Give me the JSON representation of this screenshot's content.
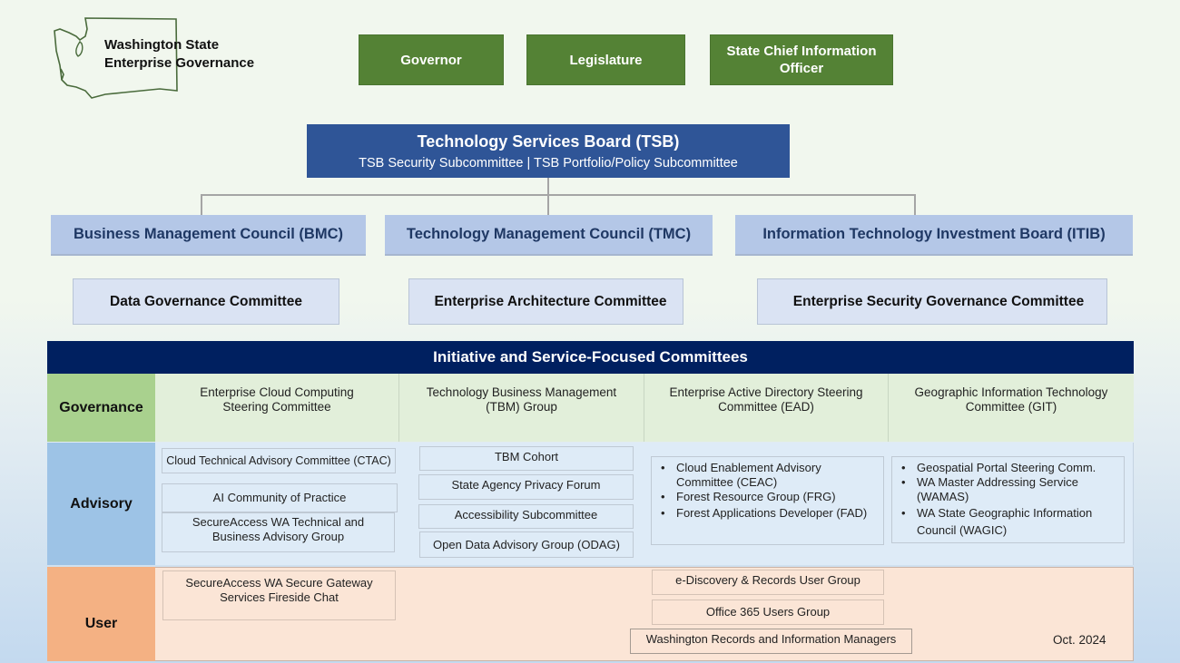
{
  "header": {
    "logo_icon": "washington-state-map-outline",
    "title_line1": "Washington State",
    "title_line2": "Enterprise Governance"
  },
  "top_authorities": [
    {
      "label": "Governor"
    },
    {
      "label": "Legislature"
    },
    {
      "label": "State Chief Information Officer"
    }
  ],
  "tsb": {
    "title": "Technology Services Board (TSB)",
    "subcommittees": "TSB Security Subcommittee | TSB Portfolio/Policy Subcommittee"
  },
  "councils": [
    {
      "label": "Business Management Council (BMC)",
      "committee": "Data Governance Committee"
    },
    {
      "label": "Technology Management Council (TMC)",
      "committee": "Enterprise Architecture Committee"
    },
    {
      "label": "Information Technology Investment Board (ITIB)",
      "committee": "Enterprise Security Governance Committee"
    }
  ],
  "initiatives": {
    "banner": "Initiative and Service-Focused Committees",
    "rows": {
      "governance": {
        "label": "Governance",
        "cells": [
          "Enterprise Cloud Computing Steering Committee",
          "Technology Business Management (TBM) Group",
          "Enterprise Active Directory Steering Committee (EAD)",
          "Geographic Information Technology Committee (GIT)"
        ]
      },
      "advisory": {
        "label": "Advisory",
        "col1": [
          "Cloud Technical Advisory Committee (CTAC)",
          "AI Community of Practice",
          "SecureAccess WA Technical and Business Advisory Group"
        ],
        "col2": [
          "TBM Cohort",
          "State Agency Privacy Forum",
          "Accessibility Subcommittee",
          "Open Data Advisory Group (ODAG)"
        ],
        "col3": [
          "Cloud Enablement Advisory Committee (CEAC)",
          "Forest Resource Group (FRG)",
          "Forest Applications Developer (FAD)"
        ],
        "col4": [
          "Geospatial Portal Steering Comm.",
          "WA Master Addressing Service (WAMAS)",
          "WA State Geographic Information Council (WAGIC)"
        ]
      },
      "user": {
        "label": "User",
        "items": [
          "SecureAccess WA Secure Gateway Services Fireside Chat",
          "e-Discovery & Records User Group",
          "Office 365 Users Group",
          "Washington Records and Information Managers"
        ]
      }
    }
  },
  "date": "Oct. 2024",
  "colors": {
    "authority_green": "#548235",
    "tsb_blue": "#2f5597",
    "council_blue": "#b4c7e7",
    "committee_blue": "#dae3f3",
    "banner_navy": "#002060",
    "governance_green": "#a9d18e",
    "advisory_blue": "#9dc3e6",
    "user_orange": "#f4b183"
  }
}
